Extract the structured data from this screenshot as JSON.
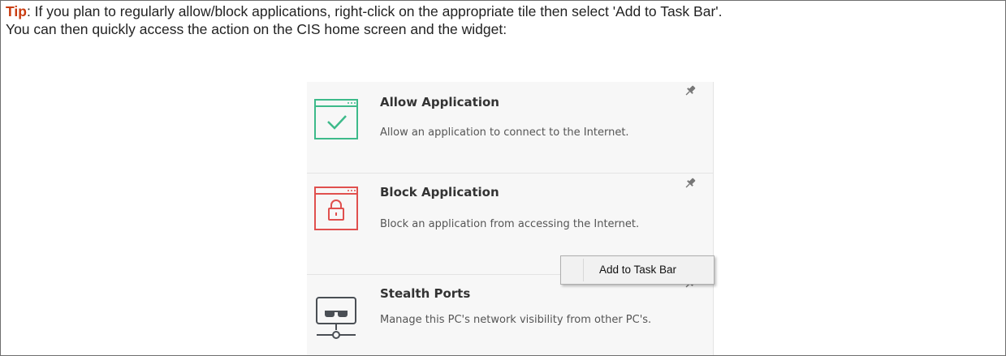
{
  "tip": {
    "label": "Tip",
    "line1": ": If you plan to regularly allow/block applications, right-click on the appropriate tile then select 'Add to Task Bar'.",
    "line2": "You can then quickly access the action on the CIS home screen and the widget:"
  },
  "tiles": [
    {
      "title": "Allow Application",
      "description": "Allow an application to connect to the Internet.",
      "icon": "allow-application-icon",
      "color": "#3dba8a"
    },
    {
      "title": "Block Application",
      "description": "Block an application from accessing the Internet.",
      "icon": "block-application-icon",
      "color": "#e0504e"
    },
    {
      "title": "Stealth Ports",
      "description": "Manage this PC's network visibility from other PC's.",
      "icon": "stealth-ports-icon",
      "color": "#4a4f55"
    }
  ],
  "context_menu": {
    "items": [
      {
        "label": "Add to Task Bar"
      }
    ]
  },
  "colors": {
    "tip_label": "#c93c10",
    "border": "#6f6f6f",
    "tile_background": "#f7f7f7"
  }
}
